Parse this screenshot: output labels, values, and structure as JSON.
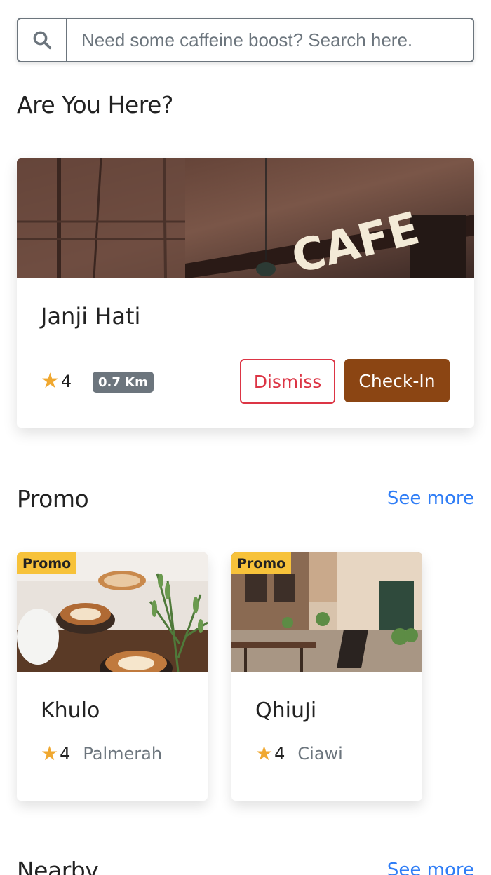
{
  "search": {
    "placeholder": "Need some caffeine boost? Search here.",
    "icon": "search-icon"
  },
  "here_section": {
    "title": "Are You Here?",
    "card": {
      "name": "Janji Hati",
      "rating": "4",
      "distance": "0.7 Km",
      "dismiss_label": "Dismiss",
      "checkin_label": "Check-In",
      "image": "cafe-sign-image",
      "sign_text": "CAFE"
    }
  },
  "promo_section": {
    "title": "Promo",
    "see_more": "See more",
    "items": [
      {
        "badge": "Promo",
        "name": "Khulo",
        "rating": "4",
        "location": "Palmerah",
        "image": "coffee-cups-image"
      },
      {
        "badge": "Promo",
        "name": "QhiuJi",
        "rating": "4",
        "location": "Ciawi",
        "image": "street-cafe-image"
      }
    ]
  },
  "nearby_section": {
    "title": "Nearby",
    "see_more": "See more"
  },
  "colors": {
    "accent": "#8b4513",
    "danger": "#dc3545",
    "link": "#2f7df6",
    "star": "#f0a830",
    "badge": "#f7c23a",
    "muted": "#6c757d"
  }
}
